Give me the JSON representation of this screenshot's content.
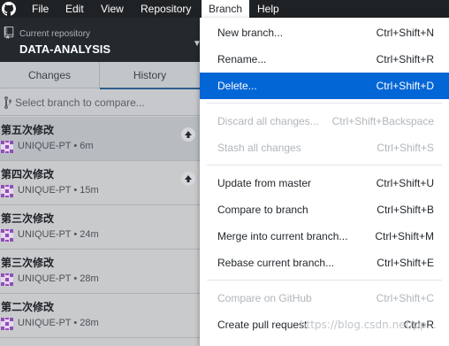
{
  "menubar": {
    "items": [
      "File",
      "Edit",
      "View",
      "Repository",
      "Branch",
      "Help"
    ]
  },
  "toolbar": {
    "repo_caption": "Current repository",
    "repo_name": "DATA-ANALYSIS"
  },
  "tabs": {
    "changes": "Changes",
    "history": "History"
  },
  "branch_compare": {
    "placeholder": "Select branch to compare..."
  },
  "commits": [
    {
      "message": "第五次修改",
      "author": "UNIQUE-PT",
      "time": "6m",
      "meta": "UNIQUE-PT • 6m",
      "unpushed": true
    },
    {
      "message": "第四次修改",
      "author": "UNIQUE-PT",
      "time": "15m",
      "meta": "UNIQUE-PT • 15m",
      "unpushed": true
    },
    {
      "message": "第三次修改",
      "author": "UNIQUE-PT",
      "time": "24m",
      "meta": "UNIQUE-PT • 24m",
      "unpushed": false
    },
    {
      "message": "第三次修改",
      "author": "UNIQUE-PT",
      "time": "28m",
      "meta": "UNIQUE-PT • 28m",
      "unpushed": false
    },
    {
      "message": "第二次修改",
      "author": "UNIQUE-PT",
      "time": "28m",
      "meta": "UNIQUE-PT • 28m",
      "unpushed": false
    }
  ],
  "branch_menu": {
    "new_branch": {
      "label": "New branch...",
      "shortcut": "Ctrl+Shift+N"
    },
    "rename": {
      "label": "Rename...",
      "shortcut": "Ctrl+Shift+R"
    },
    "delete": {
      "label": "Delete...",
      "shortcut": "Ctrl+Shift+D"
    },
    "discard_all": {
      "label": "Discard all changes...",
      "shortcut": "Ctrl+Shift+Backspace"
    },
    "stash_all": {
      "label": "Stash all changes",
      "shortcut": "Ctrl+Shift+S"
    },
    "update_from_master": {
      "label": "Update from master",
      "shortcut": "Ctrl+Shift+U"
    },
    "compare_to_branch": {
      "label": "Compare to branch",
      "shortcut": "Ctrl+Shift+B"
    },
    "merge_into_current": {
      "label": "Merge into current branch...",
      "shortcut": "Ctrl+Shift+M"
    },
    "rebase_current": {
      "label": "Rebase current branch...",
      "shortcut": "Ctrl+Shift+E"
    },
    "compare_on_github": {
      "label": "Compare on GitHub",
      "shortcut": "Ctrl+Shift+C"
    },
    "create_pull_request": {
      "label": "Create pull request",
      "shortcut": "Ctrl+R"
    }
  },
  "watermark": "https://blog.csdn.net/pp...",
  "colors": {
    "highlight": "#0366d6",
    "toolbar": "#24292e",
    "avatar": "#8e4fb7"
  }
}
